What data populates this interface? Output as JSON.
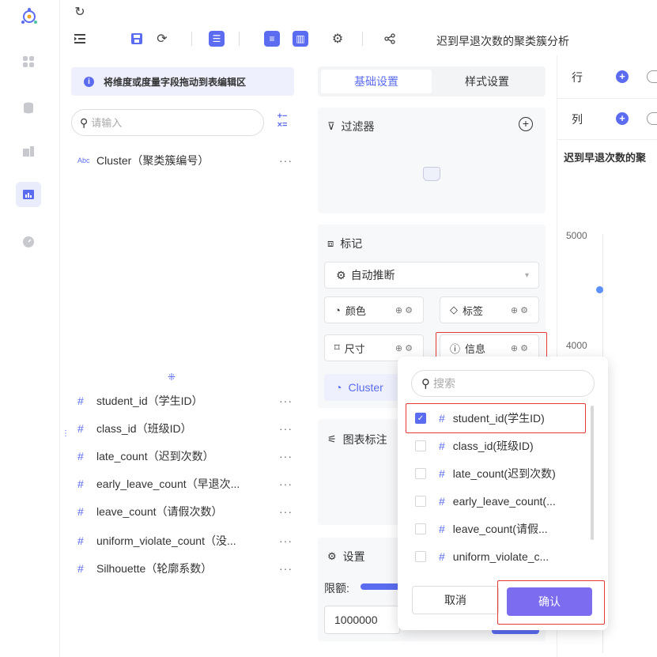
{
  "toolbar": {
    "report_title": "迟到早退次数的聚类簇分析"
  },
  "field_panel": {
    "hint": "将维度或度量字段拖动到表编辑区",
    "search_placeholder": "请输入",
    "dimensions": [
      {
        "type": "Abc",
        "name": "Cluster（聚类簇编号）",
        "more": "···"
      }
    ],
    "measures": [
      {
        "type": "#",
        "name": "student_id（学生ID）",
        "more": "···"
      },
      {
        "type": "#",
        "name": "class_id（班级ID）",
        "more": "···"
      },
      {
        "type": "#",
        "name": "late_count（迟到次数）",
        "more": "···"
      },
      {
        "type": "#",
        "name": "early_leave_count（早退次...",
        "more": "···"
      },
      {
        "type": "#",
        "name": "leave_count（请假次数）",
        "more": "···"
      },
      {
        "type": "#",
        "name": "uniform_violate_count（没...",
        "more": "···"
      },
      {
        "type": "#",
        "name": "Silhouette（轮廓系数）",
        "more": "···"
      }
    ]
  },
  "config_panel": {
    "tabs": [
      {
        "label": "基础设置",
        "active": true
      },
      {
        "label": "样式设置",
        "active": false
      }
    ],
    "filter_title": "过滤器",
    "marks_title": "标记",
    "auto_infer": "自动推断",
    "mark_chips": {
      "color": "颜色",
      "label": "标签",
      "size": "尺寸",
      "info": "信息"
    },
    "cluster_chip": "Cluster",
    "annotation_title": "图表标注",
    "settings_title": "设置",
    "limit_label": "限额:",
    "limit_value": "1000000"
  },
  "canvas": {
    "row_label": "行",
    "col_label": "列",
    "chart_title": "迟到早退次数的聚",
    "y_ticks": [
      "5000",
      "4000"
    ]
  },
  "popup": {
    "search_placeholder": "搜索",
    "options": [
      {
        "name": "student_id(学生ID)",
        "checked": true
      },
      {
        "name": "class_id(班级ID)",
        "checked": false
      },
      {
        "name": "late_count(迟到次数)",
        "checked": false
      },
      {
        "name": "early_leave_count(...",
        "checked": false
      },
      {
        "name": "leave_count(请假...",
        "checked": false
      },
      {
        "name": "uniform_violate_c...",
        "checked": false
      }
    ],
    "cancel_label": "取消",
    "confirm_label": "确认"
  },
  "colors": {
    "accent": "#5b6cf0",
    "confirm": "#7b6cf0",
    "highlight": "#e53935",
    "point": "#5b8ff9"
  }
}
